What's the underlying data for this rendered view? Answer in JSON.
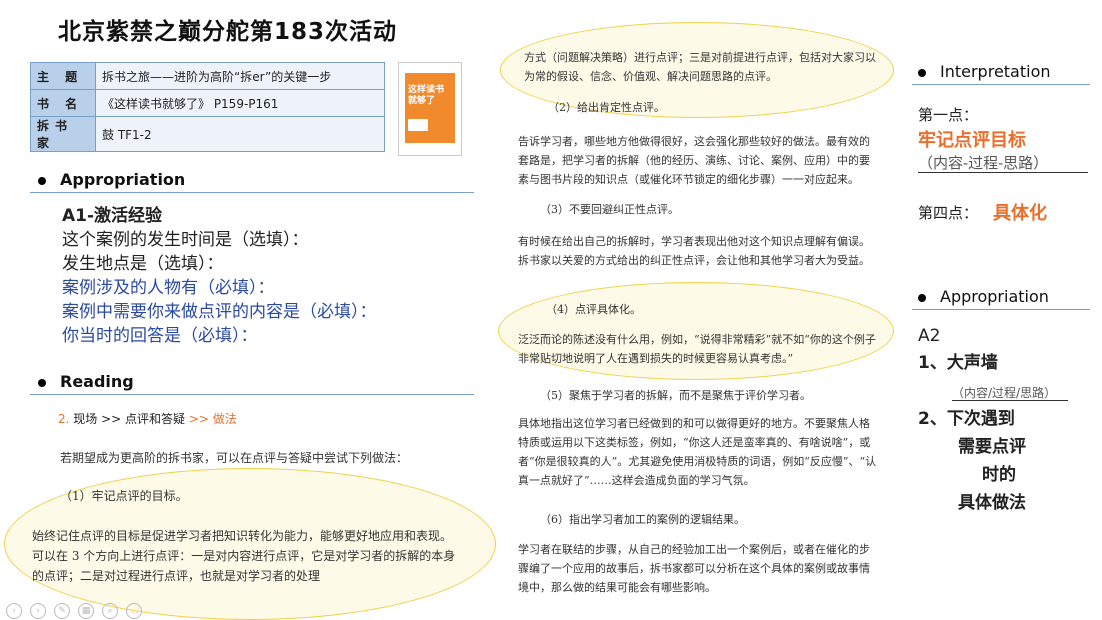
{
  "title": "北京紫禁之巅分舵第183次活动",
  "info": {
    "rows": [
      {
        "key": "主 题",
        "value": "拆书之旅——进阶为高阶“拆er”的关键一步"
      },
      {
        "key": "书 名",
        "value": "《这样读书就够了》 P159-P161"
      },
      {
        "key": "拆书家",
        "value": "鼓 TF1-2"
      }
    ]
  },
  "book_cover": {
    "title": "这样读书就够了",
    "color": "#f08a2c"
  },
  "left": {
    "appropriation_heading": "Appropriation",
    "a1_title": "A1-激活经验",
    "a1_lines": [
      "这个案例的发生时间是（选填）：",
      "发生地点是（选填）：",
      "案例涉及的人物有（必填）：",
      "案例中需要你来做点评的内容是（必填）：",
      "你当时的回答是（必填）："
    ],
    "reading_heading": "Reading",
    "reading_nav": {
      "a": "2. ",
      "b": "现场 >> 点评和答疑 ",
      "c": ">> 做法"
    },
    "reading_intro": "若期望成为更高阶的拆书家，可以在点评与答疑中尝试下列做法：",
    "point1_title": "（1）牢记点评的目标。",
    "point1_text": "始终记住点评的目标是促进学习者把知识转化为能力，能够更好地应用和表现。可以在 3 个方向上进行点评：一是对内容进行点评，它是对学习者的拆解的本身的点评；二是对过程进行点评，也就是对学习者的处理"
  },
  "middle": {
    "top_text": "方式（问题解决策略）进行点评；三是对前提进行点评，包括对大家习以为常的假设、信念、价值观、解决问题思路的点评。",
    "p2_title": "（2）给出肯定性点评。",
    "p2_text": "告诉学习者，哪些地方他做得很好，这会强化那些较好的做法。最有效的套路是，把学习者的拆解（他的经历、演练、讨论、案例、应用）中的要素与图书片段的知识点（或催化环节锁定的细化步骤）一一对应起来。",
    "p3_title": "（3）不要回避纠正性点评。",
    "p3_text": "有时候在给出自己的拆解时，学习者表现出他对这个知识点理解有偏误。拆书家以关爱的方式给出的纠正性点评，会让他和其他学习者大为受益。",
    "p4_title": "（4）点评具体化。",
    "p4_text": "泛泛而论的陈述没有什么用，例如，“说得非常精彩”就不如“你的这个例子非常贴切地说明了人在遇到损失的时候更容易认真考虑。”",
    "p5_title": "（5）聚焦于学习者的拆解，而不是聚焦于评价学习者。",
    "p5_text": "具体地指出这位学习者已经做到的和可以做得更好的地方。不要聚焦人格特质或运用以下这类标签，例如，“你这人还是蛮率真的、有啥说啥”，或者“你是很较真的人”。尤其避免使用消极特质的词语，例如“反应慢”、“认真一点就好了”……这样会造成负面的学习气氛。",
    "p6_title": "（6）指出学习者加工的案例的逻辑结果。",
    "p6_text": "学习者在联结的步骤，从自己的经验加工出一个案例后，或者在催化的步骤编了一个应用的故事后，拆书家都可以分析在这个具体的案例或故事情境中，那么做的结果可能会有哪些影响。"
  },
  "right": {
    "interpretation_heading": "Interpretation",
    "point1_label": "第一点：",
    "point1_value": "牢记点评目标",
    "point1_sub": "（内容-过程-思路）",
    "point4_label": "第四点：",
    "point4_value": "具体化",
    "appropriation_heading": "Appropriation",
    "a2": "A2",
    "a2_item1": "1、大声墙",
    "a2_item1_sub": "（内容/过程/思路）",
    "a2_item2": "2、下次遇到",
    "a2_item2_l2": "需要点评",
    "a2_item2_l3": "时的",
    "a2_item2_l4": "具体做法"
  },
  "accent_color": "#e9702c",
  "link_color": "#2a4aa0"
}
